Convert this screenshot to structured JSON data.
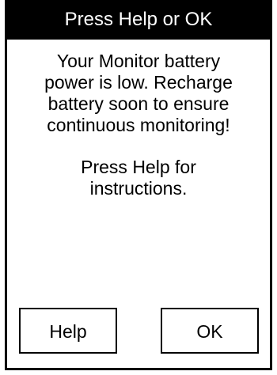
{
  "dialog": {
    "title": "Press Help or OK",
    "message_lines": [
      "Your Monitor battery",
      "power is low. Recharge",
      "battery soon to ensure",
      "continuous monitoring!"
    ],
    "help_hint_lines": [
      "Press Help for",
      "instructions."
    ],
    "buttons": {
      "help_label": "Help",
      "ok_label": "OK"
    }
  },
  "colors": {
    "title_bar_background": "#000000",
    "title_text": "#ffffff",
    "body_background": "#ffffff",
    "text": "#000000"
  }
}
